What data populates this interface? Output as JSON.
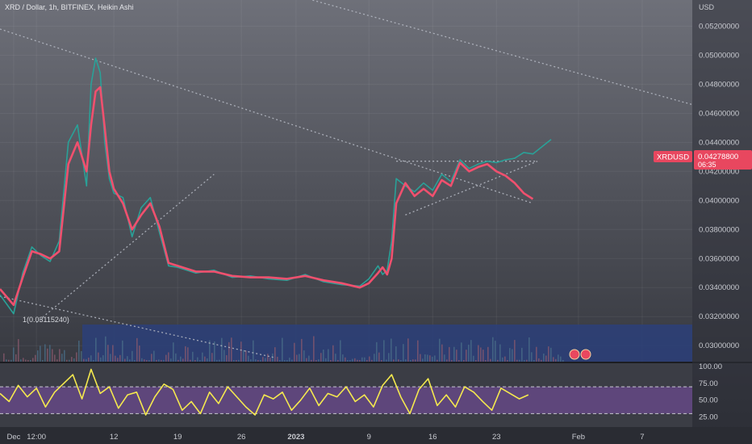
{
  "header": {
    "symbol_title": "XRD / Dollar, 1h, BITFINEX, Heikin Ashi",
    "currency": "USD"
  },
  "price_badge": {
    "ticker": "XRDUSD",
    "price": "0.04278800",
    "countdown": "06:35"
  },
  "low_marker": "1(0.03115240)",
  "colors": {
    "ma_line": "#f0506e",
    "price_line": "#2aa198",
    "rsi_line": "#f5e94e",
    "rsi_band": "#7b4fa8",
    "volume_zone": "#2c3f7a",
    "trendline": "#b8bcc6",
    "badge": "#e8475f"
  },
  "chart_data": [
    {
      "type": "line",
      "title": "",
      "y_axis_ticks": [
        "0.05200000",
        "0.05000000",
        "0.04800000",
        "0.04600000",
        "0.04400000",
        "0.04200000",
        "0.04000000",
        "0.03800000",
        "0.03600000",
        "0.03400000",
        "0.03200000",
        "0.03000000"
      ],
      "ylim": [
        0.0289,
        0.0538
      ],
      "x_axis_ticks": [
        "Dec",
        "12:00",
        "12",
        "19",
        "26",
        "2023",
        "9",
        "16",
        "23",
        "Feb",
        "7"
      ],
      "x_tick_days": [
        0,
        2.5,
        11,
        18,
        25,
        31,
        39,
        46,
        53,
        62,
        69
      ],
      "xlim": [
        -1.5,
        74.5
      ],
      "series": [
        {
          "role": "moving-average",
          "x": [
            -1.5,
            0,
            1,
            2,
            3,
            4,
            5,
            6,
            7,
            8,
            8.5,
            9,
            9.5,
            10,
            10.5,
            11,
            12,
            13,
            14,
            15,
            16,
            17,
            18,
            20,
            22,
            24,
            26,
            28,
            30,
            32,
            34,
            36,
            38,
            39,
            40,
            40.5,
            41,
            41.5,
            42,
            43,
            44,
            45,
            46,
            47,
            48,
            49,
            50,
            51,
            52,
            53,
            54,
            55,
            56,
            57
          ],
          "y": [
            0.0339,
            0.0328,
            0.0347,
            0.0365,
            0.0363,
            0.036,
            0.0365,
            0.0425,
            0.044,
            0.042,
            0.0452,
            0.0475,
            0.0478,
            0.045,
            0.042,
            0.0408,
            0.0398,
            0.038,
            0.039,
            0.0398,
            0.0382,
            0.0357,
            0.0355,
            0.0351,
            0.0351,
            0.0348,
            0.0347,
            0.0347,
            0.0346,
            0.0348,
            0.0345,
            0.0343,
            0.034,
            0.0343,
            0.035,
            0.0354,
            0.0349,
            0.036,
            0.0398,
            0.0412,
            0.0403,
            0.0408,
            0.0403,
            0.0414,
            0.041,
            0.0426,
            0.042,
            0.0423,
            0.0425,
            0.042,
            0.0417,
            0.0412,
            0.0405,
            0.0401
          ]
        },
        {
          "role": "price",
          "x": [
            -1.5,
            0,
            1,
            2,
            3,
            4,
            5,
            6,
            7,
            8,
            8.5,
            9,
            9.5,
            10,
            10.5,
            11,
            12,
            13,
            14,
            15,
            16,
            17,
            18,
            20,
            22,
            24,
            26,
            28,
            30,
            32,
            34,
            36,
            38,
            39,
            40,
            40.5,
            41,
            41.5,
            42,
            43,
            44,
            45,
            46,
            47,
            48,
            49,
            50,
            51,
            52,
            53,
            54,
            55,
            56,
            57,
            58,
            59
          ],
          "y": [
            0.0335,
            0.0322,
            0.035,
            0.0368,
            0.0362,
            0.0358,
            0.0372,
            0.044,
            0.0452,
            0.041,
            0.048,
            0.0498,
            0.0488,
            0.044,
            0.0415,
            0.0405,
            0.0402,
            0.0375,
            0.0395,
            0.0402,
            0.0378,
            0.0355,
            0.0354,
            0.035,
            0.0352,
            0.0347,
            0.0348,
            0.0346,
            0.0345,
            0.0349,
            0.0344,
            0.0342,
            0.0341,
            0.0346,
            0.0355,
            0.0349,
            0.0352,
            0.0372,
            0.0415,
            0.041,
            0.0406,
            0.0412,
            0.0407,
            0.0418,
            0.0413,
            0.0428,
            0.0422,
            0.0425,
            0.0427,
            0.0426,
            0.0428,
            0.0429,
            0.0433,
            0.0432,
            0.0437,
            0.0442
          ]
        }
      ]
    },
    {
      "type": "line",
      "title": "",
      "y_axis_ticks": [
        "100.00",
        "75.00",
        "50.00",
        "25.00"
      ],
      "ylim": [
        10,
        105
      ],
      "band": [
        30,
        70
      ],
      "xlim": [
        -1.5,
        74.5
      ],
      "series": [
        {
          "role": "rsi",
          "x": [
            -1.5,
            -0.5,
            0.5,
            1.5,
            2.5,
            3.5,
            4.5,
            5.5,
            6.5,
            7.5,
            8.5,
            9.5,
            10.5,
            11.5,
            12.5,
            13.5,
            14.5,
            15.5,
            16.5,
            17.5,
            18.5,
            19.5,
            20.5,
            21.5,
            22.5,
            23.5,
            24.5,
            25.5,
            26.5,
            27.5,
            28.5,
            29.5,
            30.5,
            31.5,
            32.5,
            33.5,
            34.5,
            35.5,
            36.5,
            37.5,
            38.5,
            39.5,
            40.5,
            41.5,
            42.5,
            43.5,
            44.5,
            45.5,
            46.5,
            47.5,
            48.5,
            49.5,
            50.5,
            51.5,
            52.5,
            53.5,
            54.5,
            55.5,
            56.5
          ],
          "y": [
            60,
            48,
            72,
            55,
            68,
            40,
            62,
            75,
            88,
            52,
            96,
            60,
            70,
            38,
            58,
            62,
            28,
            55,
            74,
            66,
            35,
            48,
            30,
            62,
            45,
            70,
            55,
            40,
            28,
            58,
            52,
            62,
            35,
            50,
            68,
            42,
            60,
            55,
            70,
            48,
            58,
            40,
            72,
            88,
            55,
            30,
            66,
            82,
            42,
            58,
            40,
            70,
            62,
            48,
            35,
            68,
            60,
            52,
            58
          ]
        }
      ]
    }
  ]
}
